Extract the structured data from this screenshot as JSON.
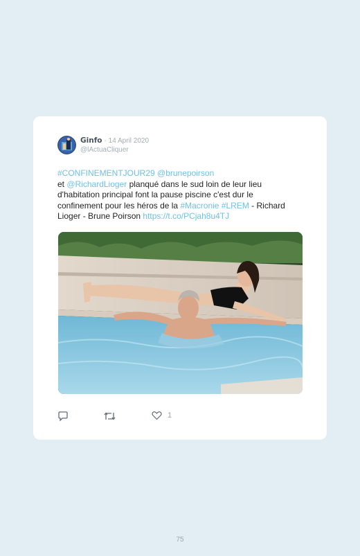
{
  "tweet": {
    "author_name": "Ginfo",
    "date": "· 14 April 2020",
    "handle": "@lActuaCliquer",
    "text": {
      "hashtag1": "#CONFINEMENTJOUR29",
      "mention1": "@brunepoirson",
      "part1": "et ",
      "mention2": "@RichardLioger",
      "part2": " planqué dans le sud loin de leur lieu d'habitation principal font la pause piscine c'est dur le confinement pour les héros de la ",
      "hashtag2": "#Macronie",
      "hashtag3": "#LREM",
      "part3": " - Richard Lioger - Brune Poirson ",
      "url": "https://t.co/PCjah8u4TJ"
    },
    "likes": "1"
  },
  "icons": {
    "reply": "reply-icon",
    "retweet": "retweet-icon",
    "like": "heart-icon"
  },
  "colors": {
    "background": "#e2eef3",
    "card": "#ffffff",
    "link": "#6cc1e6"
  },
  "page_number": "75"
}
